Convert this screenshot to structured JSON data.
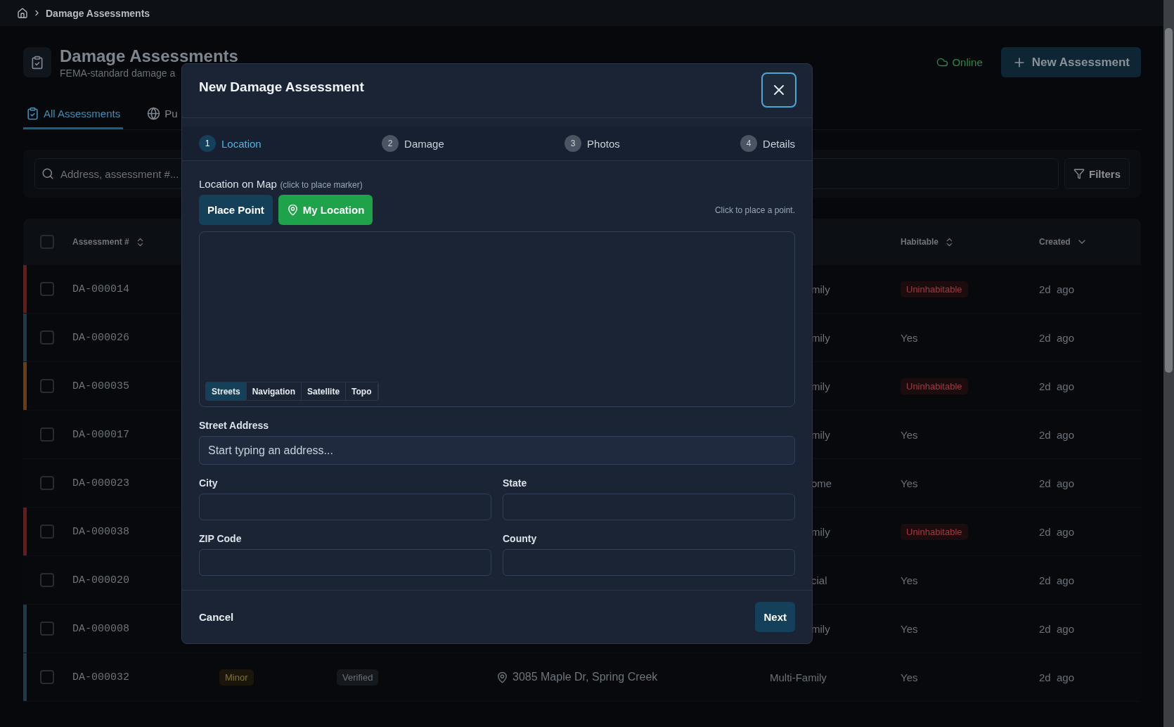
{
  "breadcrumb": {
    "current": "Damage Assessments"
  },
  "header": {
    "title": "Damage Assessments",
    "subtitle": "FEMA-standard damage a",
    "status": "Online",
    "online": true,
    "new_button": "New Assessment"
  },
  "tabs": [
    {
      "label": "All Assessments",
      "selected": true
    },
    {
      "label": "Pu",
      "selected": false
    }
  ],
  "search": {
    "placeholder": "Address, assessment #...",
    "filters_button": "Filters"
  },
  "table": {
    "select_all": {
      "checked": false
    },
    "columns": [
      "Assessment #",
      "Habitable",
      "Created"
    ],
    "rows": [
      {
        "id": "DA-000014",
        "color": "#6b1a1a",
        "checked": false,
        "type": "mily",
        "habitable": "Uninhabitable",
        "uninhabitable": true,
        "created": "2d  ago"
      },
      {
        "id": "DA-000026",
        "color": "#1c3a48",
        "checked": false,
        "type": "mily",
        "habitable": "Yes",
        "uninhabitable": false,
        "created": "2d  ago"
      },
      {
        "id": "DA-000035",
        "color": "#6b3d0e",
        "checked": false,
        "type": "mily",
        "habitable": "Uninhabitable",
        "uninhabitable": true,
        "created": "2d  ago"
      },
      {
        "id": "DA-000017",
        "checked": false,
        "type": "mily",
        "habitable": "Yes",
        "uninhabitable": false,
        "created": "2d  ago"
      },
      {
        "id": "DA-000023",
        "checked": false,
        "type": "ome",
        "habitable": "Yes",
        "uninhabitable": false,
        "created": "2d  ago"
      },
      {
        "id": "DA-000038",
        "color": "#6b1a1a",
        "checked": false,
        "type": "mily",
        "habitable": "Uninhabitable",
        "uninhabitable": true,
        "created": "2d  ago"
      },
      {
        "id": "DA-000020",
        "checked": false,
        "type": "cial",
        "habitable": "Yes",
        "uninhabitable": false,
        "created": "2d  ago"
      },
      {
        "id": "DA-000008",
        "color": "#1c3a48",
        "checked": false,
        "type": "mily",
        "habitable": "Yes",
        "uninhabitable": false,
        "created": "2d  ago"
      },
      {
        "id": "DA-000032",
        "color": "#1c3a48",
        "checked": false,
        "severity": "Minor",
        "status": "Verified",
        "address": "3085 Maple Dr, Spring Creek",
        "type": "Multi-Family",
        "habitable": "Yes",
        "uninhabitable": false,
        "created": "2d  ago"
      }
    ]
  },
  "modal": {
    "title": "New Damage Assessment",
    "steps": [
      {
        "number": "1",
        "label": "Location",
        "selected": true
      },
      {
        "number": "2",
        "label": "Damage",
        "selected": false
      },
      {
        "number": "3",
        "label": "Photos",
        "selected": false
      },
      {
        "number": "4",
        "label": "Details",
        "selected": false
      }
    ],
    "map_label": "Location on Map",
    "map_hint": "(click to place marker)",
    "place_point_button": "Place Point",
    "my_location_button": "My Location",
    "map_status": "Click to place a point.",
    "layers": [
      {
        "label": "Streets",
        "selected": true
      },
      {
        "label": "Navigation",
        "selected": false
      },
      {
        "label": "Satellite",
        "selected": false
      },
      {
        "label": "Topo",
        "selected": false
      }
    ],
    "fields": [
      {
        "label": "Street Address",
        "placeholder": "Start typing an address..."
      },
      {
        "label": "City"
      },
      {
        "label": "State"
      },
      {
        "label": "ZIP Code"
      },
      {
        "label": "County"
      }
    ],
    "cancel_button": "Cancel",
    "next_button": "Next"
  }
}
